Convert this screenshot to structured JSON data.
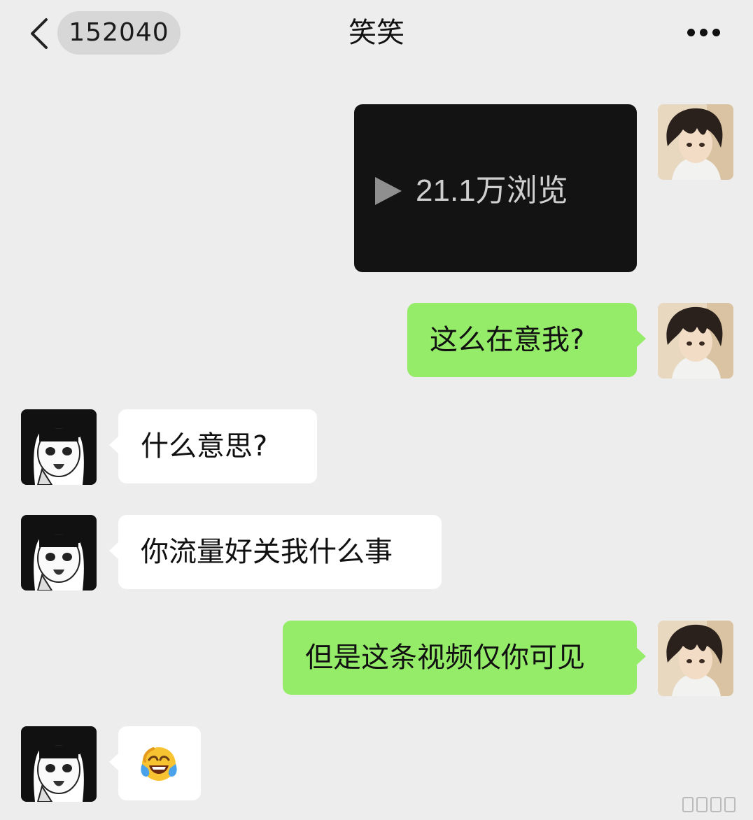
{
  "header": {
    "back_icon": "chevron-left-icon",
    "unread_count": "152040",
    "title": "笑笑",
    "more_icon": "more-dots-icon"
  },
  "messages": [
    {
      "direction": "out",
      "type": "video",
      "play_icon": "play-icon",
      "view_count": "21.1万浏览"
    },
    {
      "direction": "out",
      "type": "text",
      "text": "这么在意我?"
    },
    {
      "direction": "in",
      "type": "text",
      "text": "什么意思?"
    },
    {
      "direction": "in",
      "type": "text",
      "text": "你流量好关我什么事"
    },
    {
      "direction": "out",
      "type": "text",
      "text": "但是这条视频仅你可见"
    },
    {
      "direction": "in",
      "type": "emoji",
      "emoji": "face-with-tears-of-joy-icon"
    }
  ],
  "colors": {
    "background": "#ededed",
    "outgoing_bubble": "#95ec69",
    "incoming_bubble": "#ffffff",
    "badge": "#d7d7d7",
    "video_card": "#131313"
  }
}
